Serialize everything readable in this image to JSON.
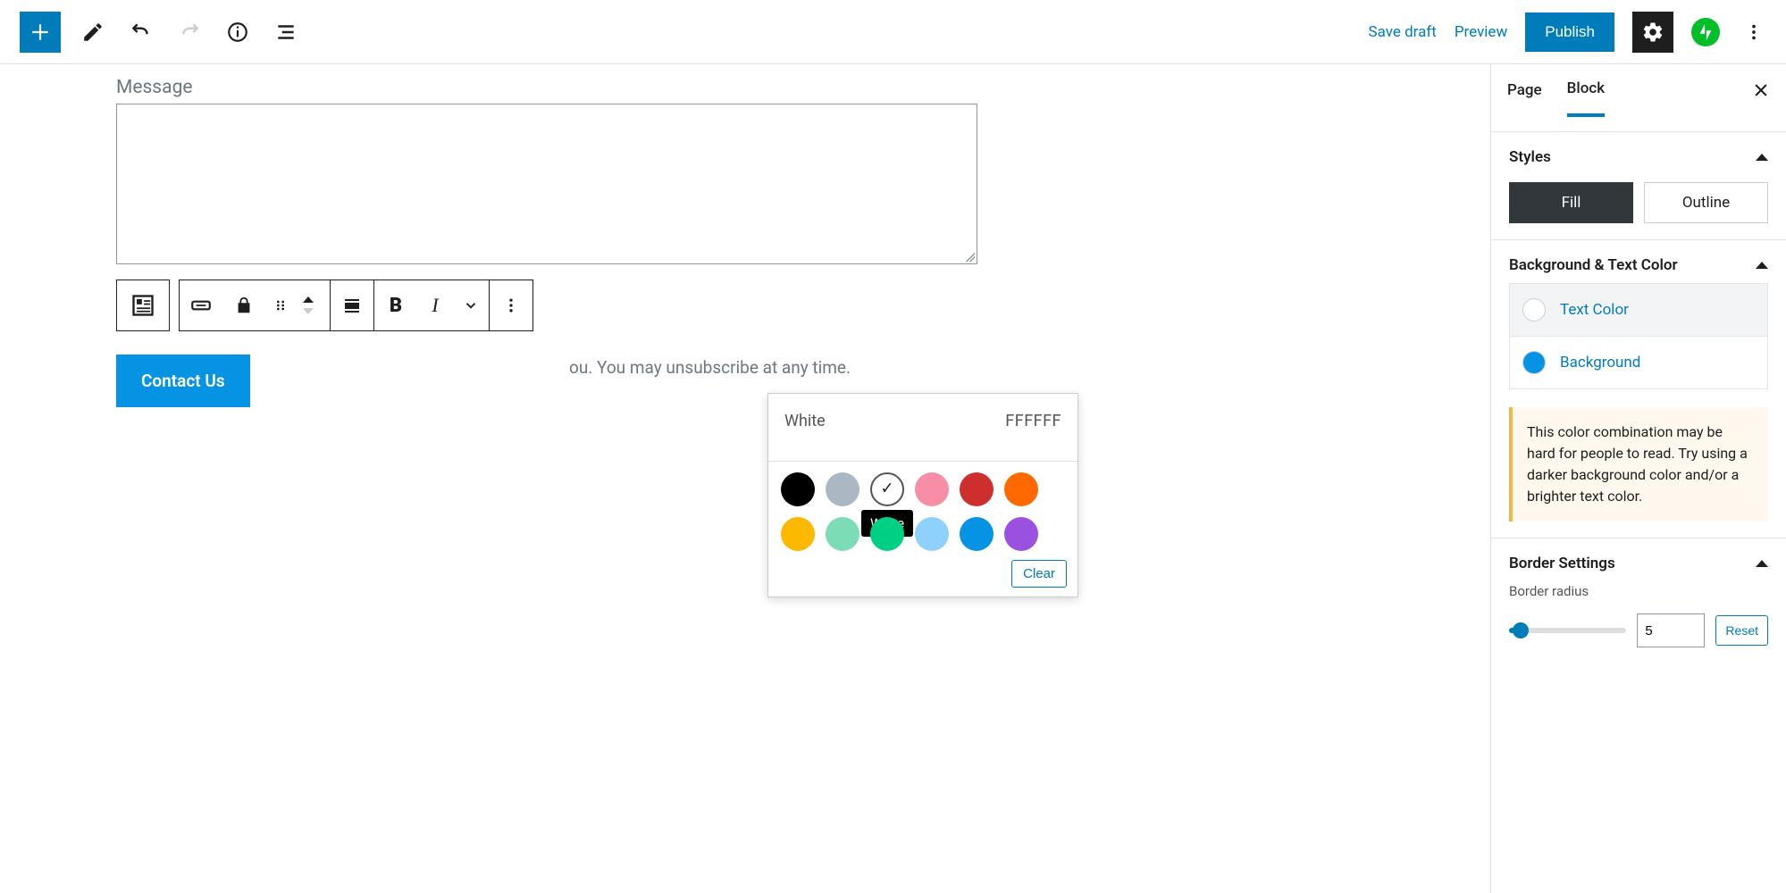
{
  "topbar": {
    "save_draft": "Save draft",
    "preview": "Preview",
    "publish": "Publish"
  },
  "canvas": {
    "message_label": "Message",
    "trailing_text": "ou. You may unsubscribe at any time.",
    "button_label": "Contact Us"
  },
  "popover": {
    "color_name": "White",
    "hex": "FFFFFF",
    "tooltip": "White",
    "clear": "Clear",
    "swatches": [
      "#000000",
      "#abb8c3",
      "#ffffff",
      "#f78da7",
      "#cf2e2e",
      "#ff6900",
      "#fcb900",
      "#7bdcb5",
      "#00d084",
      "#8ed1fc",
      "#0693e3",
      "#9b51e0"
    ],
    "selected_index": 2
  },
  "sidebar": {
    "tabs": {
      "page": "Page",
      "block": "Block"
    },
    "styles": {
      "title": "Styles",
      "fill": "Fill",
      "outline": "Outline"
    },
    "colors": {
      "title": "Background & Text Color",
      "text": "Text Color",
      "background": "Background",
      "text_value": "#ffffff",
      "background_value": "#0693e3"
    },
    "notice": "This color combination may be hard for people to read. Try using a darker background color and/or a brighter text color.",
    "border": {
      "title": "Border Settings",
      "radius_label": "Border radius",
      "radius_value": "5",
      "reset": "Reset"
    }
  }
}
